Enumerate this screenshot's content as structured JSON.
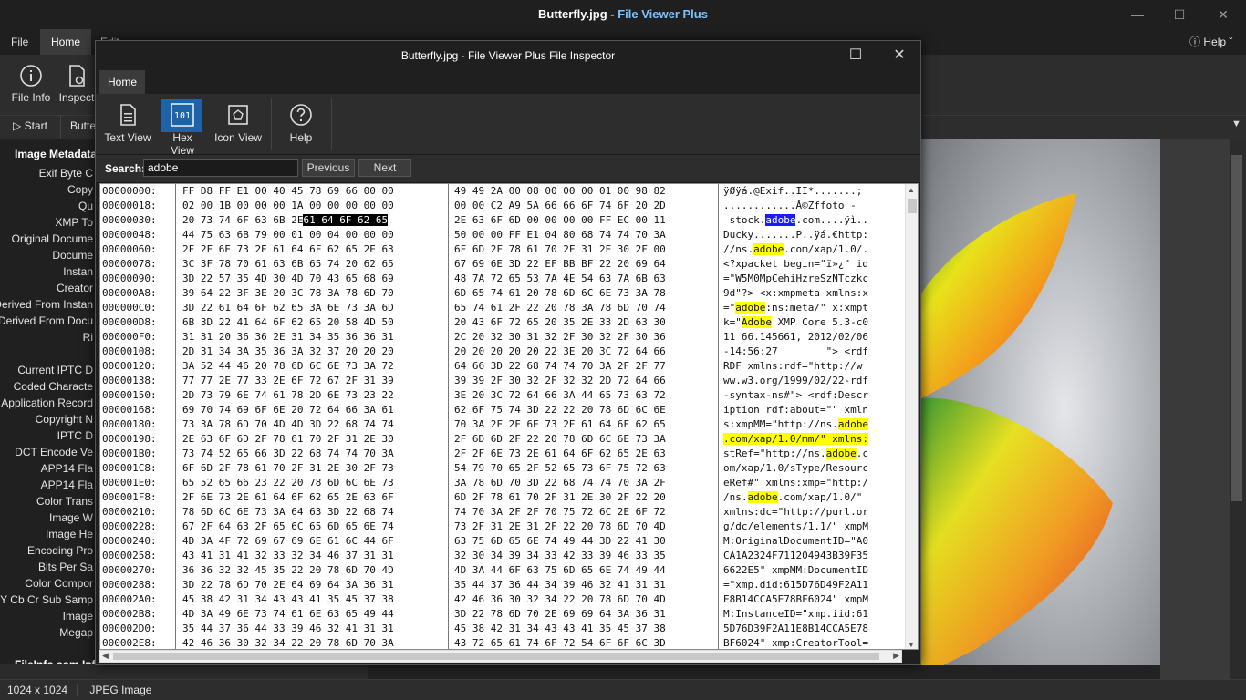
{
  "window": {
    "title_file": "Butterfly.jpg - ",
    "title_app": "File Viewer Plus"
  },
  "menu": {
    "tabs": [
      "File",
      "Home",
      "Edit"
    ],
    "help": "Help"
  },
  "ribbon": {
    "file_info": "File Info",
    "inspect": "Inspect"
  },
  "toolbar2": {
    "start": "Start",
    "butte": "Butte"
  },
  "sidebar": {
    "heading": "Image Metadata",
    "keys": [
      "Exif Byte C",
      "Copy",
      "Qu",
      "XMP To",
      "Original Docume",
      "Docume",
      "Instan",
      "Creator",
      "Derived From Instan",
      "Derived From Docu",
      "Ri",
      "",
      "Current IPTC D",
      "Coded Characte",
      "Application Record",
      "Copyright N",
      "IPTC D",
      "DCT Encode Ve",
      "APP14 Fla",
      "APP14 Fla",
      "Color Trans",
      "Image W",
      "Image He",
      "Encoding Pro",
      "Bits Per Sa",
      "Color Compor",
      "Y Cb Cr Sub Samp",
      "Image",
      "Megap"
    ],
    "footer": "FileInfo.com Information"
  },
  "status": {
    "dimensions": "1024 x 1024",
    "type": "JPEG Image"
  },
  "dialog": {
    "title": "Butterfly.jpg - File Viewer Plus File Inspector",
    "tab": "Home",
    "buttons": {
      "text_view": "Text View",
      "hex_view": "Hex View",
      "icon_view": "Icon View",
      "help": "Help"
    },
    "search": {
      "label": "Search:",
      "value": "adobe",
      "previous": "Previous",
      "next": "Next"
    }
  },
  "hex": {
    "offsets": [
      "00000000:",
      "00000018:",
      "00000030:",
      "00000048:",
      "00000060:",
      "00000078:",
      "00000090:",
      "000000A8:",
      "000000C0:",
      "000000D8:",
      "000000F0:",
      "00000108:",
      "00000120:",
      "00000138:",
      "00000150:",
      "00000168:",
      "00000180:",
      "00000198:",
      "000001B0:",
      "000001C8:",
      "000001E0:",
      "000001F8:",
      "00000210:",
      "00000228:",
      "00000240:",
      "00000258:",
      "00000270:",
      "00000288:",
      "000002A0:",
      "000002B8:",
      "000002D0:",
      "000002E8:"
    ],
    "hex1": [
      "FF D8 FF E1 00 40 45 78 69 66 00 00",
      "02 00 1B 00 00 00 1A 00 00 00 00 00",
      "20 73 74 6F 63 6B 2E|61 64 6F 62 65",
      "44 75 63 6B 79 00 01 00 04 00 00 00",
      "2F 2F 6E 73 2E 61 64 6F 62 65 2E 63",
      "3C 3F 78 70 61 63 6B 65 74 20 62 65",
      "3D 22 57 35 4D 30 4D 70 43 65 68 69",
      "39 64 22 3F 3E 20 3C 78 3A 78 6D 70",
      "3D 22 61 64 6F 62 65 3A 6E 73 3A 6D",
      "6B 3D 22 41 64 6F 62 65 20 58 4D 50",
      "31 31 20 36 36 2E 31 34 35 36 36 31",
      "2D 31 34 3A 35 36 3A 32 37 20 20 20",
      "3A 52 44 46 20 78 6D 6C 6E 73 3A 72",
      "77 77 2E 77 33 2E 6F 72 67 2F 31 39",
      "2D 73 79 6E 74 61 78 2D 6E 73 23 22",
      "69 70 74 69 6F 6E 20 72 64 66 3A 61",
      "73 3A 78 6D 70 4D 4D 3D 22 68 74 74",
      "2E 63 6F 6D 2F 78 61 70 2F 31 2E 30",
      "73 74 52 65 66 3D 22 68 74 74 70 3A",
      "6F 6D 2F 78 61 70 2F 31 2E 30 2F 73",
      "65 52 65 66 23 22 20 78 6D 6C 6E 73",
      "2F 6E 73 2E 61 64 6F 62 65 2E 63 6F",
      "78 6D 6C 6E 73 3A 64 63 3D 22 68 74",
      "67 2F 64 63 2F 65 6C 65 6D 65 6E 74",
      "4D 3A 4F 72 69 67 69 6E 61 6C 44 6F",
      "43 41 31 41 32 33 32 34 46 37 31 31",
      "36 36 32 32 45 35 22 20 78 6D 70 4D",
      "3D 22 78 6D 70 2E 64 69 64 3A 36 31",
      "45 38 42 31 34 43 43 41 35 45 37 38",
      "4D 3A 49 6E 73 74 61 6E 63 65 49 44",
      "35 44 37 36 44 33 39 46 32 41 31 31",
      "42 46 36 30 32 34 22 20 78 6D 70 3A"
    ],
    "hex2": [
      "49 49 2A 00 08 00 00 00 01 00 98 82",
      "00 00 C2 A9 5A 66 66 6F 74 6F 20 2D",
      "2E 63 6F 6D 00 00 00 00 FF EC 00 11",
      "50 00 00 FF E1 04 80 68 74 74 70 3A",
      "6F 6D 2F 78 61 70 2F 31 2E 30 2F 00",
      "67 69 6E 3D 22 EF BB BF 22 20 69 64",
      "48 7A 72 65 53 7A 4E 54 63 7A 6B 63",
      "6D 65 74 61 20 78 6D 6C 6E 73 3A 78",
      "65 74 61 2F 22 20 78 3A 78 6D 70 74",
      "20 43 6F 72 65 20 35 2E 33 2D 63 30",
      "2C 20 32 30 31 32 2F 30 32 2F 30 36",
      "20 20 20 20 20 22 3E 20 3C 72 64 66",
      "64 66 3D 22 68 74 74 70 3A 2F 2F 77",
      "39 39 2F 30 32 2F 32 32 2D 72 64 66",
      "3E 20 3C 72 64 66 3A 44 65 73 63 72",
      "62 6F 75 74 3D 22 22 20 78 6D 6C 6E",
      "70 3A 2F 2F 6E 73 2E 61 64 6F 62 65",
      "2F 6D 6D 2F 22 20 78 6D 6C 6E 73 3A",
      "2F 2F 6E 73 2E 61 64 6F 62 65 2E 63",
      "54 79 70 65 2F 52 65 73 6F 75 72 63",
      "3A 78 6D 70 3D 22 68 74 74 70 3A 2F",
      "6D 2F 78 61 70 2F 31 2E 30 2F 22 20",
      "74 70 3A 2F 2F 70 75 72 6C 2E 6F 72",
      "73 2F 31 2E 31 2F 22 20 78 6D 70 4D",
      "63 75 6D 65 6E 74 49 44 3D 22 41 30",
      "32 30 34 39 34 33 42 33 39 46 33 35",
      "4D 3A 44 6F 63 75 6D 65 6E 74 49 44",
      "35 44 37 36 44 34 39 46 32 41 31 31",
      "42 46 36 30 32 34 22 20 78 6D 70 4D",
      "3D 22 78 6D 70 2E 69 69 64 3A 36 31",
      "45 38 42 31 34 43 43 41 35 45 37 38",
      "43 72 65 61 74 6F 72 54 6F 6F 6C 3D"
    ],
    "ascii": [
      "ÿØÿá.@Exif..II*.......;",
      "............Â©Zffoto -",
      " stock.|adobe|.com....ÿì..",
      "Ducky.......P..ÿá.€http:",
      "//ns.|adobe|.com/xap/1.0/.",
      "<?xpacket begin=\"ï»¿\" id",
      "=\"W5M0MpCehiHzreSzNTczkc",
      "9d\"?> <x:xmpmeta xmlns:x",
      "=\"|adobe|:ns:meta/\" x:xmpt",
      "k=\"|Adobe| XMP Core 5.3-c0",
      "11 66.145661, 2012/02/06",
      "-14:56:27        \"> <rdf",
      "RDF xmlns:rdf=\"http://w",
      "ww.w3.org/1999/02/22-rdf",
      "-syntax-ns#\"> <rdf:Descr",
      "iption rdf:about=\"\" xmln",
      "s:xmpMM=\"http://ns.|adobe",
      "|.com/xap/1.0/mm/\" xmlns:",
      "stRef=\"http://ns.|adobe|.c",
      "om/xap/1.0/sType/Resourc",
      "eRef#\" xmlns:xmp=\"http:/",
      "/ns.|adobe|.com/xap/1.0/\"",
      "xmlns:dc=\"http://purl.or",
      "g/dc/elements/1.1/\" xmpM",
      "M:OriginalDocumentID=\"A0",
      "CA1A2324F711204943B39F35",
      "6622E5\" xmpMM:DocumentID",
      "=\"xmp.did:615D76D49F2A11",
      "E8B14CCA5E78BF6024\" xmpM",
      "M:InstanceID=\"xmp.iid:61",
      "5D76D39F2A11E8B14CCA5E78",
      "BF6024\" xmp:CreatorTool="
    ]
  }
}
